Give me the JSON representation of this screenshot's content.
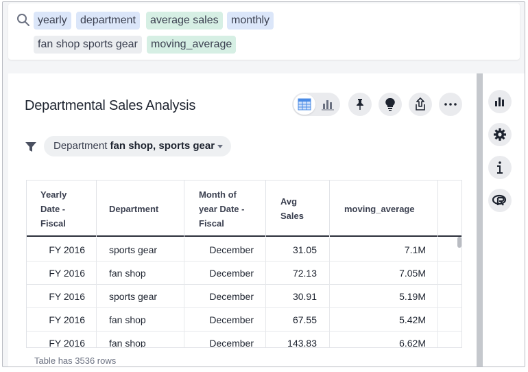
{
  "search": {
    "tokens": [
      {
        "label": "yearly",
        "kind": "blue"
      },
      {
        "label": "department",
        "kind": "blue"
      },
      {
        "label": "average sales",
        "kind": "green"
      },
      {
        "label": "monthly",
        "kind": "blue"
      },
      {
        "label": "fan shop sports gear",
        "kind": "gray"
      },
      {
        "label": "moving_average",
        "kind": "green"
      }
    ]
  },
  "card": {
    "title": "Departmental Sales Analysis",
    "toolbar": {
      "table_view": "table-icon",
      "chart_view": "bar-chart-icon",
      "pin": "pin-icon",
      "insights": "lightbulb-icon",
      "share": "share-icon",
      "more": "more-icon"
    }
  },
  "filter": {
    "label": "Department",
    "value": "fan shop, sports gear"
  },
  "table": {
    "columns": [
      "Yearly Date - Fiscal",
      "Department",
      "Month of year Date - Fiscal",
      "Avg Sales",
      "moving_average"
    ],
    "rows": [
      [
        "FY 2016",
        "sports gear",
        "December",
        "31.05",
        "7.1M"
      ],
      [
        "FY 2016",
        "fan shop",
        "December",
        "72.13",
        "7.05M"
      ],
      [
        "FY 2016",
        "sports gear",
        "December",
        "30.91",
        "5.19M"
      ],
      [
        "FY 2016",
        "fan shop",
        "December",
        "67.55",
        "5.42M"
      ],
      [
        "FY 2016",
        "fan shop",
        "December",
        "143.83",
        "6.62M"
      ]
    ],
    "footer": "Table has 3536 rows"
  },
  "right_panel": {
    "icons": [
      "chart-config-icon",
      "gear-icon",
      "info-icon",
      "r-icon"
    ]
  },
  "colors": {
    "token_blue": "#dbe6f9",
    "token_green": "#d6efe4",
    "token_gray": "#ebedf0",
    "table_active": "#4a8be6"
  }
}
